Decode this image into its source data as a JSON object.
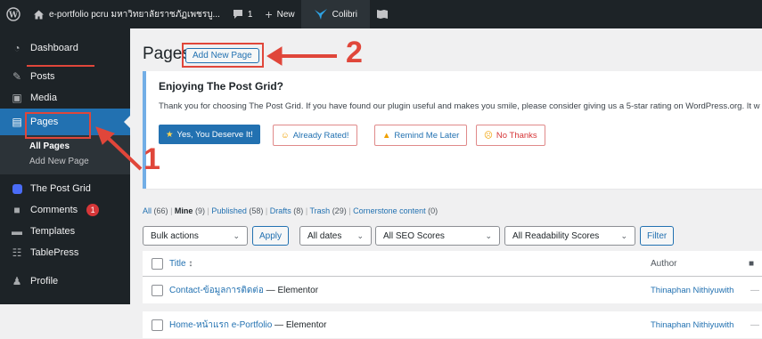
{
  "topbar": {
    "site_name": "e-portfolio pcru มหาวิทยาลัยราชภัฏเพชรบู...",
    "comments_count": "1",
    "new_label": "New",
    "colibri_label": "Colibri"
  },
  "sidebar": {
    "items": [
      {
        "label": "Dashboard",
        "icon": "dashboard-icon"
      },
      {
        "label": "Posts",
        "icon": "pin-icon"
      },
      {
        "label": "Media",
        "icon": "media-icon"
      },
      {
        "label": "Pages",
        "icon": "page-icon"
      },
      {
        "label": "The Post Grid",
        "icon": "grid-icon"
      },
      {
        "label": "Comments",
        "icon": "comment-icon",
        "badge": "1"
      },
      {
        "label": "Templates",
        "icon": "folder-icon"
      },
      {
        "label": "TablePress",
        "icon": "table-icon"
      },
      {
        "label": "Profile",
        "icon": "user-icon"
      }
    ],
    "submenu": [
      "All Pages",
      "Add New Page"
    ]
  },
  "main": {
    "title": "Pages",
    "add_new_label": "Add New Page"
  },
  "notice": {
    "heading": "Enjoying The Post Grid?",
    "text": "Thank you for choosing The Post Grid. If you have found our plugin useful and makes you smile, please consider giving us a 5-star rating on WordPress.org. It w",
    "buttons": [
      "Yes, You Deserve It!",
      "Already Rated!",
      "Remind Me Later",
      "No Thanks"
    ]
  },
  "views": {
    "all": "All",
    "all_count": "(66)",
    "mine": "Mine",
    "mine_count": "(9)",
    "published": "Published",
    "published_count": "(58)",
    "drafts": "Drafts",
    "drafts_count": "(8)",
    "trash": "Trash",
    "trash_count": "(29)",
    "cornerstone": "Cornerstone content",
    "cornerstone_count": "(0)"
  },
  "filters": {
    "bulk_actions": "Bulk actions",
    "apply": "Apply",
    "dates": "All dates",
    "seo": "All SEO Scores",
    "readability": "All Readability Scores",
    "filter": "Filter"
  },
  "table": {
    "col_title": "Title",
    "col_author": "Author",
    "rows": [
      {
        "title": "Contact-ข้อมูลการติดต่อ",
        "suffix": " — Elementor",
        "author": "Thinaphan Nithiyuwith"
      },
      {
        "title": "Home-หน้าแรก e-Portfolio",
        "suffix": " — Elementor",
        "author": "Thinaphan Nithiyuwith"
      }
    ]
  },
  "annotations": {
    "step1": "1",
    "step2": "2",
    "color": "#e0463a"
  }
}
